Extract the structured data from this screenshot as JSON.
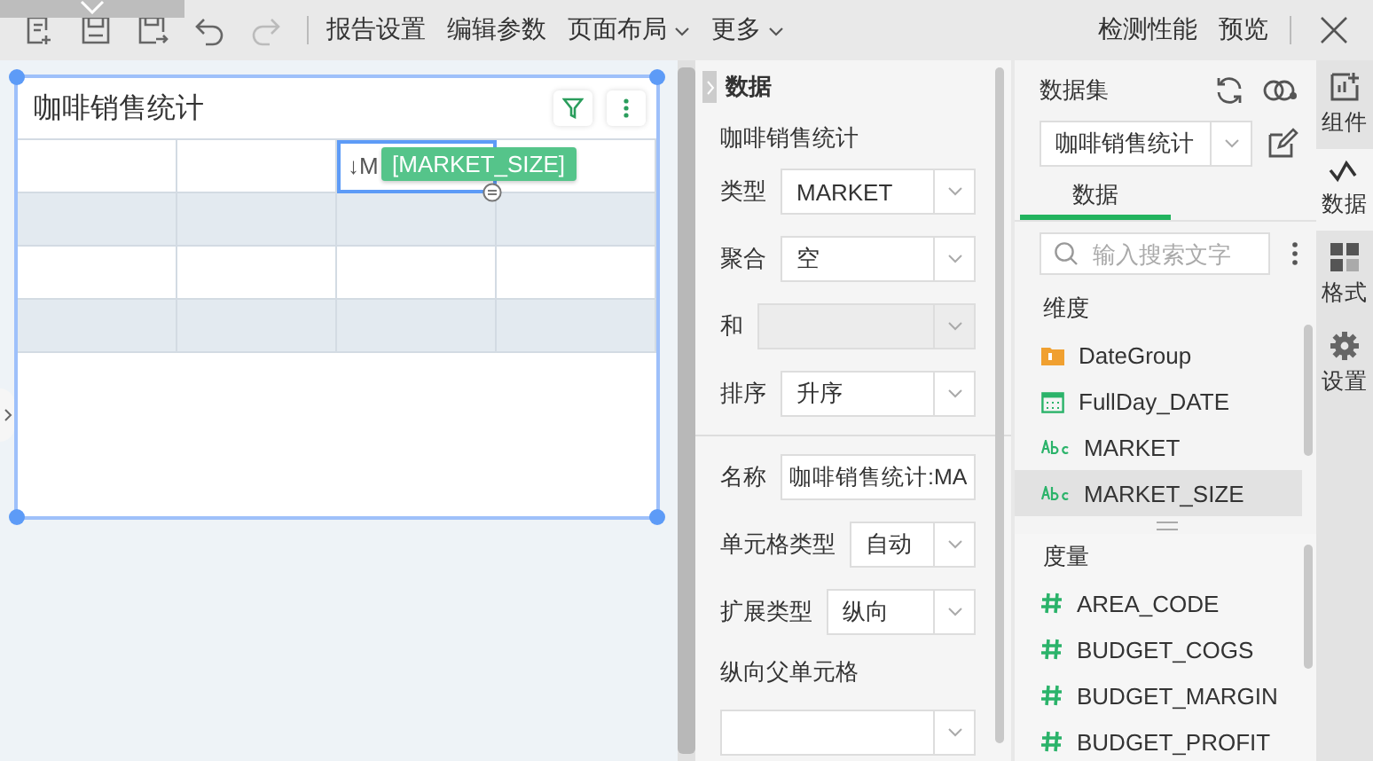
{
  "toolbar": {
    "menus": [
      {
        "label": "报告设置",
        "dropdown": false
      },
      {
        "label": "编辑参数",
        "dropdown": false
      },
      {
        "label": "页面布局",
        "dropdown": true
      },
      {
        "label": "更多",
        "dropdown": true
      }
    ],
    "right_links": [
      "检测性能",
      "预览"
    ]
  },
  "widget": {
    "title": "咖啡销售统计",
    "drag_tag": "[MARKET_SIZE]",
    "rows": [
      {
        "shaded": false,
        "cells": [
          {
            "selected": false
          },
          {
            "selected": false
          },
          {
            "selected": true,
            "text": "↓M"
          },
          {
            "selected": false
          }
        ]
      },
      {
        "shaded": true,
        "cells": [
          {
            "selected": false
          },
          {
            "selected": false
          },
          {
            "selected": false
          },
          {
            "selected": false
          }
        ]
      },
      {
        "shaded": false,
        "cells": [
          {
            "selected": false
          },
          {
            "selected": false
          },
          {
            "selected": false
          },
          {
            "selected": false
          }
        ]
      },
      {
        "shaded": true,
        "cells": [
          {
            "selected": false
          },
          {
            "selected": false
          },
          {
            "selected": false
          },
          {
            "selected": false
          }
        ]
      }
    ]
  },
  "properties": {
    "title": "数据",
    "subtitle": "咖啡销售统计",
    "sections": [
      {
        "fields": [
          {
            "label": "类型",
            "kind": "select",
            "value": "MARKET",
            "disabled": false
          },
          {
            "label": "聚合",
            "kind": "select",
            "value": "空",
            "disabled": false
          },
          {
            "label": "和",
            "kind": "select",
            "disabled": true
          },
          {
            "label": "排序",
            "kind": "select",
            "value": "升序",
            "disabled": false
          }
        ]
      },
      {
        "fields": [
          {
            "label": "名称",
            "kind": "text",
            "value": "咖啡销售统计:MA",
            "disabled": false
          },
          {
            "label": "单元格类型",
            "kind": "select",
            "value": "自动",
            "disabled": false
          },
          {
            "label": "扩展类型",
            "kind": "select",
            "value": "纵向",
            "disabled": false
          },
          {
            "label": "纵向父单元格",
            "kind": "stacked-select",
            "disabled": false
          }
        ]
      }
    ]
  },
  "dataset_panel": {
    "title": "数据集",
    "dataset": "咖啡销售统计",
    "tabs": [
      {
        "label": "数据",
        "selected": true
      }
    ],
    "search": {
      "placeholder": "输入搜索文字"
    },
    "groups": [
      {
        "label": "维度",
        "items": [
          {
            "name": "DateGroup",
            "kind": "folder",
            "selected": false
          },
          {
            "name": "FullDay_DATE",
            "kind": "date",
            "selected": false
          },
          {
            "name": "MARKET",
            "kind": "text",
            "selected": false
          },
          {
            "name": "MARKET_SIZE",
            "kind": "text",
            "selected": true
          }
        ]
      },
      {
        "label": "度量",
        "items": [
          {
            "name": "AREA_CODE",
            "kind": "number",
            "selected": false
          },
          {
            "name": "BUDGET_COGS",
            "kind": "number",
            "selected": false
          },
          {
            "name": "BUDGET_MARGIN",
            "kind": "number",
            "selected": false
          },
          {
            "name": "BUDGET_PROFIT",
            "kind": "number",
            "selected": false
          }
        ]
      }
    ]
  },
  "side_tabs": [
    {
      "label": "组件",
      "kind": "component",
      "selected": false
    },
    {
      "label": "数据",
      "kind": "data",
      "selected": true
    },
    {
      "label": "格式",
      "kind": "format",
      "selected": false
    },
    {
      "label": "设置",
      "kind": "settings",
      "selected": false
    }
  ]
}
